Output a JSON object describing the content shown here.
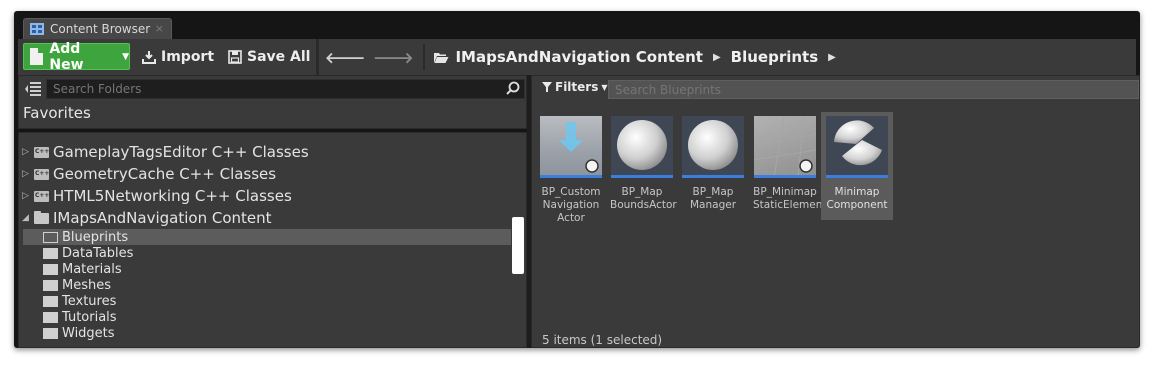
{
  "tab": {
    "title": "Content Browser",
    "close": "×"
  },
  "toolbar": {
    "add_new": "Add New",
    "import": "Import",
    "save_all": "Save All",
    "accent": "#3ea53e"
  },
  "breadcrumb": {
    "root": "IMapsAndNavigation Content",
    "current": "Blueprints"
  },
  "folders": {
    "search_placeholder": "Search Folders",
    "favorites": "Favorites",
    "roots": [
      {
        "label": "GameplayTagsEditor C++ Classes",
        "icon": "cpp-folder-icon"
      },
      {
        "label": "GeometryCache C++ Classes",
        "icon": "cpp-folder-icon"
      },
      {
        "label": "HTML5Networking C++ Classes",
        "icon": "cpp-folder-icon"
      },
      {
        "label": "IMapsAndNavigation Content",
        "icon": "folder-open-icon"
      }
    ],
    "children": [
      {
        "label": "Blueprints",
        "selected": true
      },
      {
        "label": "DataTables"
      },
      {
        "label": "Materials"
      },
      {
        "label": "Meshes"
      },
      {
        "label": "Textures"
      },
      {
        "label": "Tutorials"
      },
      {
        "label": "Widgets"
      }
    ]
  },
  "assets": {
    "filters": "Filters",
    "search_placeholder": "Search Blueprints",
    "items": [
      {
        "line1": "BP_Custom",
        "line2": "Navigation",
        "line3": "Actor"
      },
      {
        "line1": "BP_Map",
        "line2": "BoundsActor"
      },
      {
        "line1": "BP_Map",
        "line2": "Manager"
      },
      {
        "line1": "BP_Minimap",
        "line2": "StaticElement"
      },
      {
        "line1": "Minimap",
        "line2": "Component",
        "selected": true
      }
    ],
    "status": "5 items (1 selected)"
  }
}
